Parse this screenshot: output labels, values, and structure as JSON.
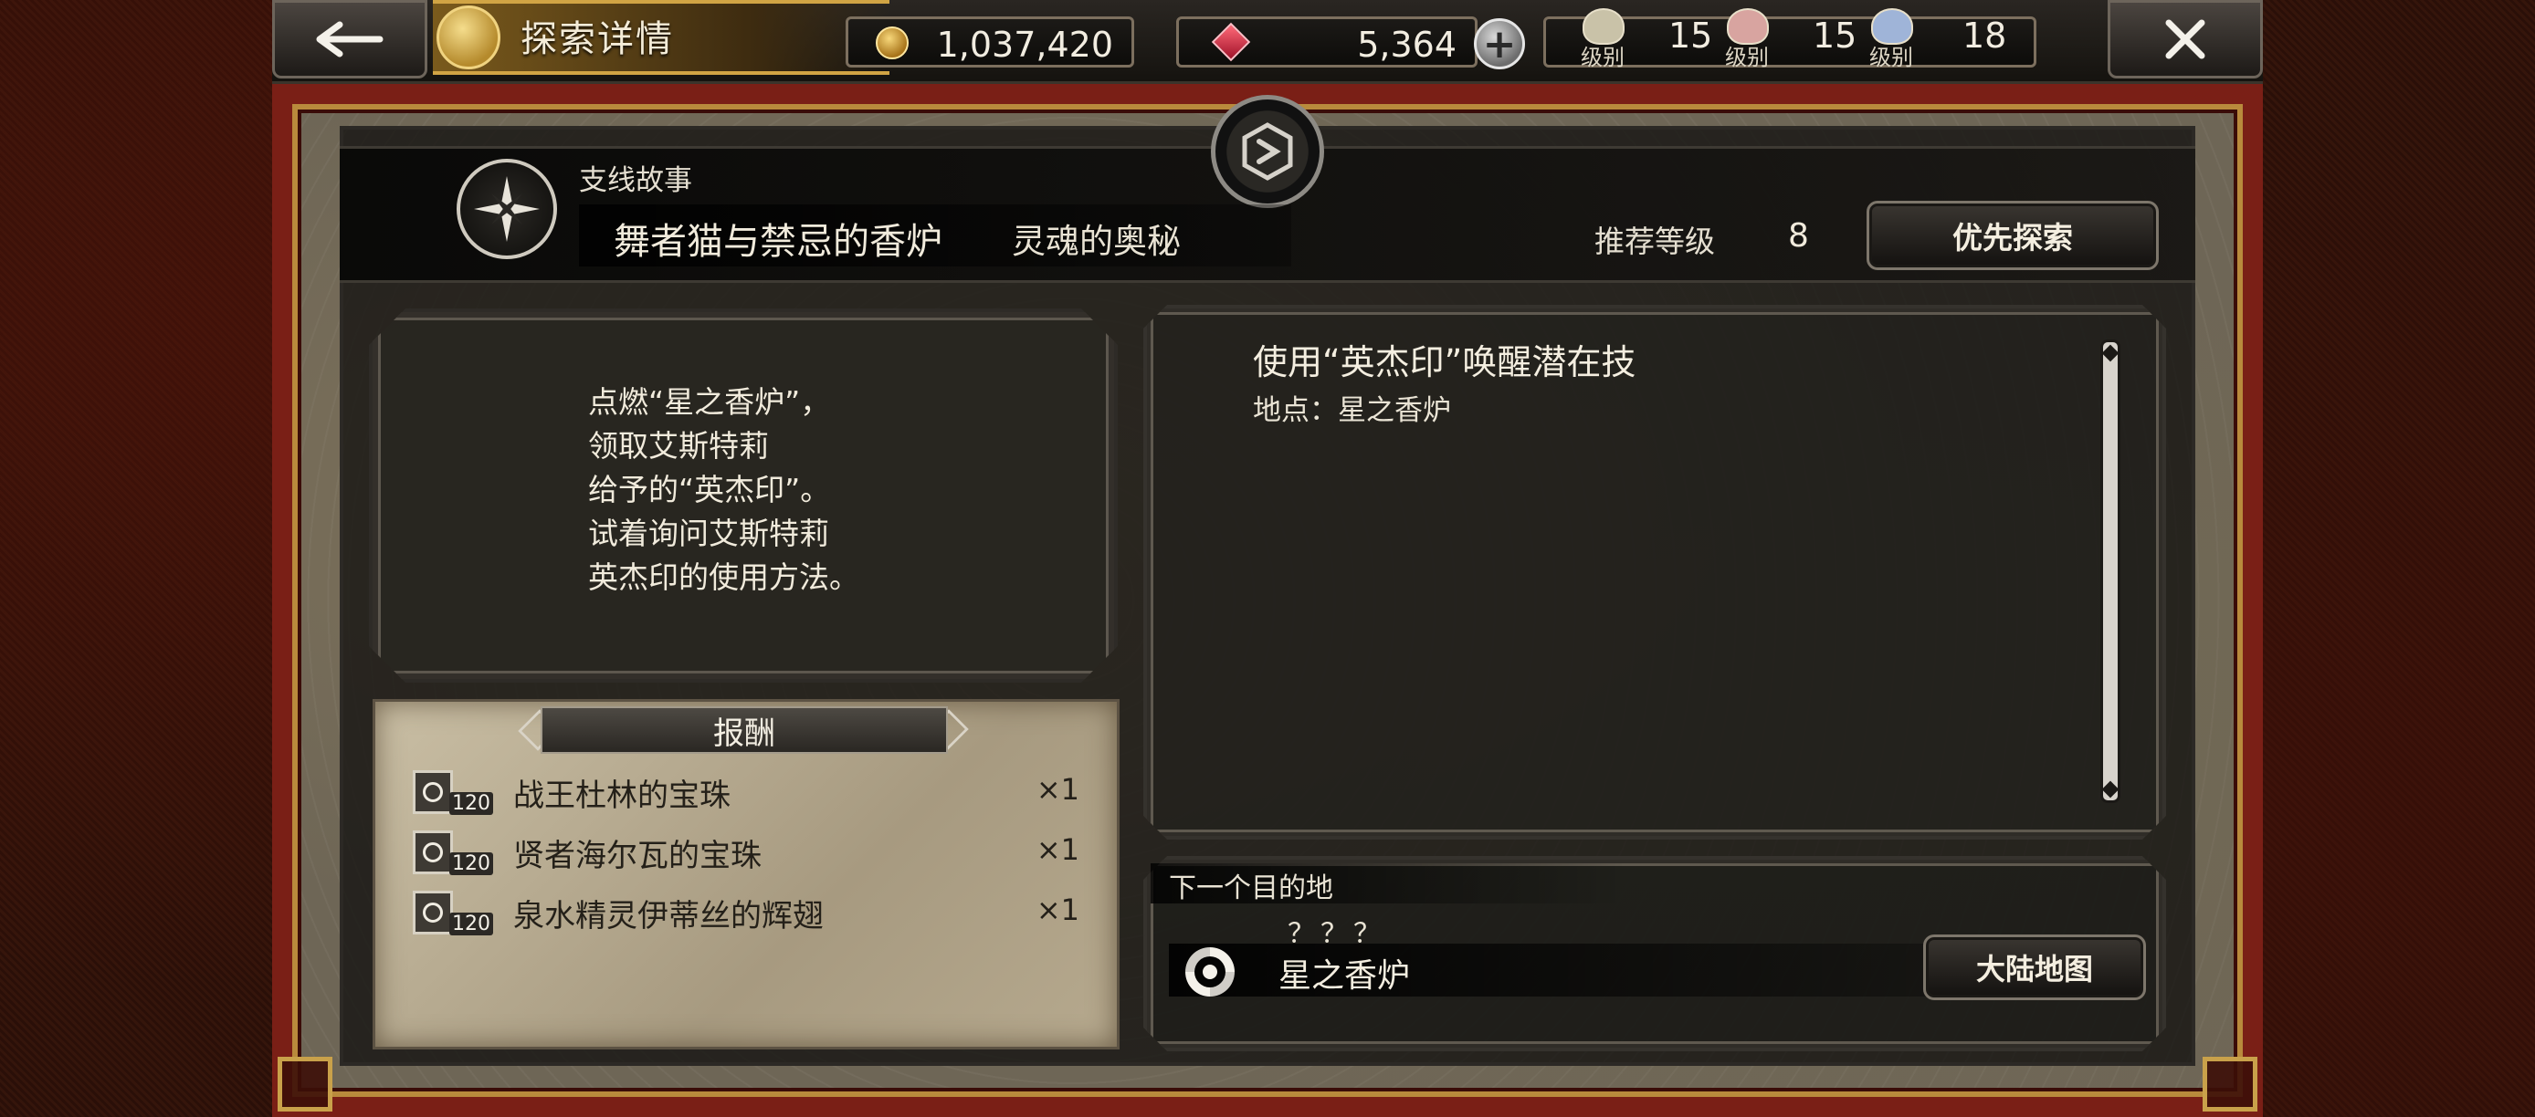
{
  "header": {
    "title": "探索详情",
    "back_icon": "arrow-left-icon",
    "close_icon": "close-icon"
  },
  "resources": {
    "gold": "1,037,420",
    "gems": "5,364",
    "levels": [
      {
        "label": "级别",
        "value": "15",
        "color": "#c9c2a8"
      },
      {
        "label": "级别",
        "value": "15",
        "color": "#d8a4a0"
      },
      {
        "label": "级别",
        "value": "18",
        "color": "#9fb4d8"
      }
    ]
  },
  "quest": {
    "category": "支线故事",
    "name": "舞者猫与禁忌的香炉",
    "subtitle": "灵魂的奥秘",
    "recommended_level_label": "推荐等级",
    "recommended_level": "8",
    "priority_button": "优先探索"
  },
  "description": [
    "点燃“星之香炉”，",
    "领取艾斯特莉",
    "给予的“英杰印”。",
    "试着询问艾斯特莉",
    "英杰印的使用方法。"
  ],
  "rewards": {
    "header": "报酬",
    "items": [
      {
        "name": "战王杜林的宝珠",
        "qty": "×1",
        "badge": "120"
      },
      {
        "name": "贤者海尔瓦的宝珠",
        "qty": "×1",
        "badge": "120"
      },
      {
        "name": "泉水精灵伊蒂丝的辉翅",
        "qty": "×1",
        "badge": "120"
      }
    ]
  },
  "objective": {
    "title": "使用“英杰印”唤醒潜在技",
    "location": "地点：星之香炉"
  },
  "next_destination": {
    "label": "下一个目的地",
    "unknown": "？？？",
    "name": "星之香炉",
    "map_button": "大陆地图"
  },
  "colors": {
    "frame_red": "#7a1f16",
    "gold_trim": "#c9a14a",
    "panel_dark": "#12110f",
    "parchment": "#c9bea4"
  }
}
